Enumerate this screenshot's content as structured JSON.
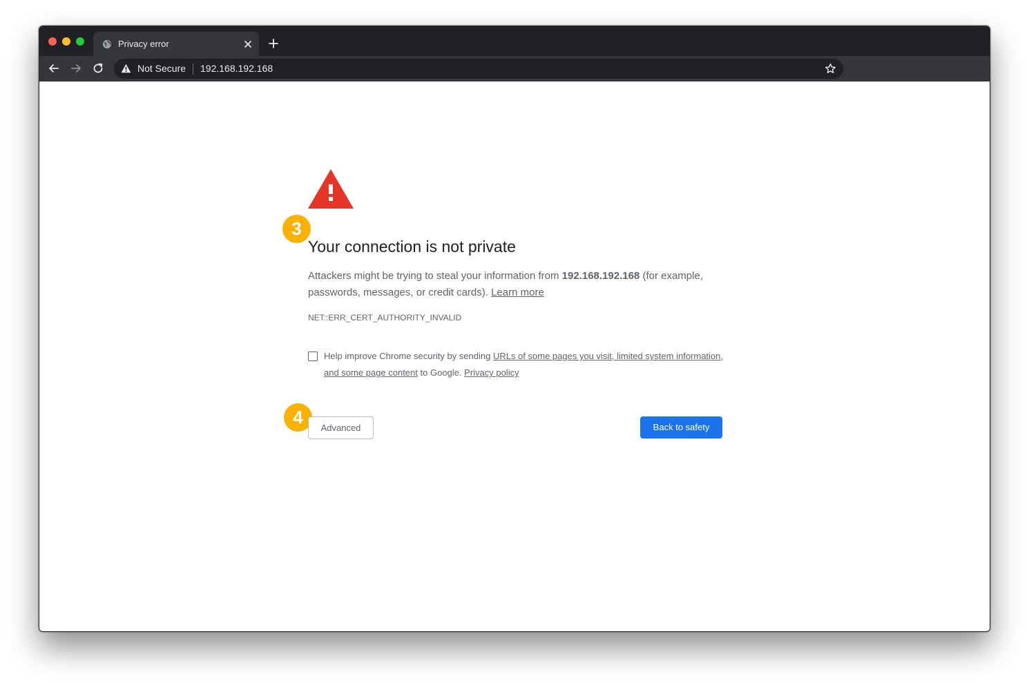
{
  "tab": {
    "title": "Privacy error",
    "favicon": "globe-icon"
  },
  "toolbar": {
    "security_label": "Not Secure",
    "url": "192.168.192.168"
  },
  "page": {
    "headline": "Your connection is not private",
    "description_prefix": "Attackers might be trying to steal your information from ",
    "host": "192.168.192.168",
    "description_suffix": " (for example, passwords, messages, or credit cards). ",
    "learn_more": "Learn more",
    "error_code": "NET::ERR_CERT_AUTHORITY_INVALID",
    "optin_prefix": "Help improve Chrome security by sending ",
    "optin_link": "URLs of some pages you visit, limited system information, and some page content",
    "optin_middle": " to Google. ",
    "privacy_link": "Privacy policy",
    "advanced_label": "Advanced",
    "back_label": "Back to safety",
    "checkbox_checked": false
  },
  "annotations": {
    "step_3": "3",
    "step_4": "4"
  },
  "colors": {
    "warning_red": "#e53527",
    "primary_blue": "#1a73e8",
    "badge_yellow": "#f9b200",
    "chrome_dark": "#202124"
  }
}
